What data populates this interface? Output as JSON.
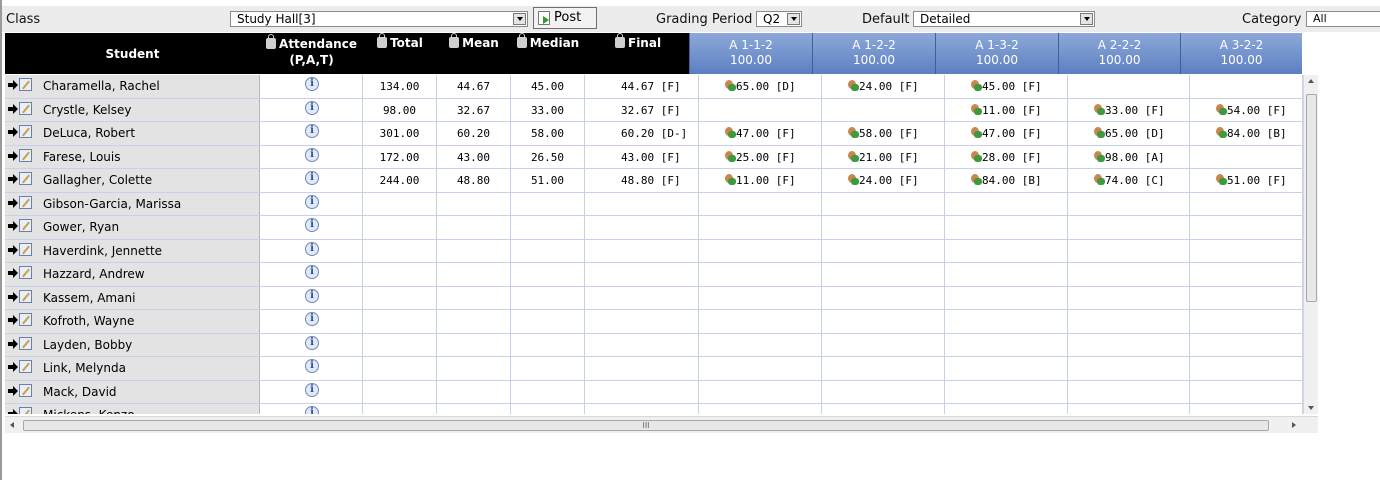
{
  "toolbar": {
    "class_label": "Class",
    "class_value": "Study Hall[3]",
    "post_label": "Post",
    "grading_period_label": "Grading Period",
    "grading_period_value": "Q2",
    "default_label": "Default",
    "default_value": "Detailed",
    "category_label": "Category",
    "category_value": "All"
  },
  "headers": {
    "student": "Student",
    "attendance_line1": "Attendance",
    "attendance_line2": "(P,A,T)",
    "total": "Total",
    "mean": "Mean",
    "median": "Median",
    "final": "Final"
  },
  "assignments": [
    {
      "name": "A 1-1-2",
      "points": "100.00"
    },
    {
      "name": "A 1-2-2",
      "points": "100.00"
    },
    {
      "name": "A 1-3-2",
      "points": "100.00"
    },
    {
      "name": "A 2-2-2",
      "points": "100.00"
    },
    {
      "name": "A 3-2-2",
      "points": "100.00"
    }
  ],
  "rows": [
    {
      "name": "Charamella, Rachel",
      "total": "134.00",
      "mean": "44.67",
      "median": "45.00",
      "final": "44.67 [F]",
      "scores": [
        "65.00 [D]",
        "24.00 [F]",
        "45.00 [F]",
        "",
        ""
      ]
    },
    {
      "name": "Crystle, Kelsey",
      "total": "98.00",
      "mean": "32.67",
      "median": "33.00",
      "final": "32.67 [F]",
      "scores": [
        "",
        "",
        "11.00 [F]",
        "33.00 [F]",
        "54.00 [F]"
      ]
    },
    {
      "name": "DeLuca, Robert",
      "total": "301.00",
      "mean": "60.20",
      "median": "58.00",
      "final": "60.20 [D-]",
      "scores": [
        "47.00 [F]",
        "58.00 [F]",
        "47.00 [F]",
        "65.00 [D]",
        "84.00 [B]"
      ]
    },
    {
      "name": "Farese, Louis",
      "total": "172.00",
      "mean": "43.00",
      "median": "26.50",
      "final": "43.00 [F]",
      "scores": [
        "25.00 [F]",
        "21.00 [F]",
        "28.00 [F]",
        "98.00 [A]",
        ""
      ]
    },
    {
      "name": "Gallagher, Colette",
      "total": "244.00",
      "mean": "48.80",
      "median": "51.00",
      "final": "48.80 [F]",
      "scores": [
        "11.00 [F]",
        "24.00 [F]",
        "84.00 [B]",
        "74.00 [C]",
        "51.00 [F]"
      ]
    },
    {
      "name": "Gibson-Garcia, Marissa",
      "total": "",
      "mean": "",
      "median": "",
      "final": "",
      "scores": [
        "",
        "",
        "",
        "",
        ""
      ]
    },
    {
      "name": "Gower, Ryan",
      "total": "",
      "mean": "",
      "median": "",
      "final": "",
      "scores": [
        "",
        "",
        "",
        "",
        ""
      ]
    },
    {
      "name": "Haverdink, Jennette",
      "total": "",
      "mean": "",
      "median": "",
      "final": "",
      "scores": [
        "",
        "",
        "",
        "",
        ""
      ]
    },
    {
      "name": "Hazzard, Andrew",
      "total": "",
      "mean": "",
      "median": "",
      "final": "",
      "scores": [
        "",
        "",
        "",
        "",
        ""
      ]
    },
    {
      "name": "Kassem, Amani",
      "total": "",
      "mean": "",
      "median": "",
      "final": "",
      "scores": [
        "",
        "",
        "",
        "",
        ""
      ]
    },
    {
      "name": "Kofroth, Wayne",
      "total": "",
      "mean": "",
      "median": "",
      "final": "",
      "scores": [
        "",
        "",
        "",
        "",
        ""
      ]
    },
    {
      "name": "Layden, Bobby",
      "total": "",
      "mean": "",
      "median": "",
      "final": "",
      "scores": [
        "",
        "",
        "",
        "",
        ""
      ]
    },
    {
      "name": "Link, Melynda",
      "total": "",
      "mean": "",
      "median": "",
      "final": "",
      "scores": [
        "",
        "",
        "",
        "",
        ""
      ]
    },
    {
      "name": "Mack, David",
      "total": "",
      "mean": "",
      "median": "",
      "final": "",
      "scores": [
        "",
        "",
        "",
        "",
        ""
      ]
    },
    {
      "name": "Mickens, Kenzo",
      "total": "",
      "mean": "",
      "median": "",
      "final": "",
      "scores": [
        "",
        "",
        "",
        "",
        ""
      ]
    }
  ],
  "scrollbar": {
    "grip": "III"
  }
}
